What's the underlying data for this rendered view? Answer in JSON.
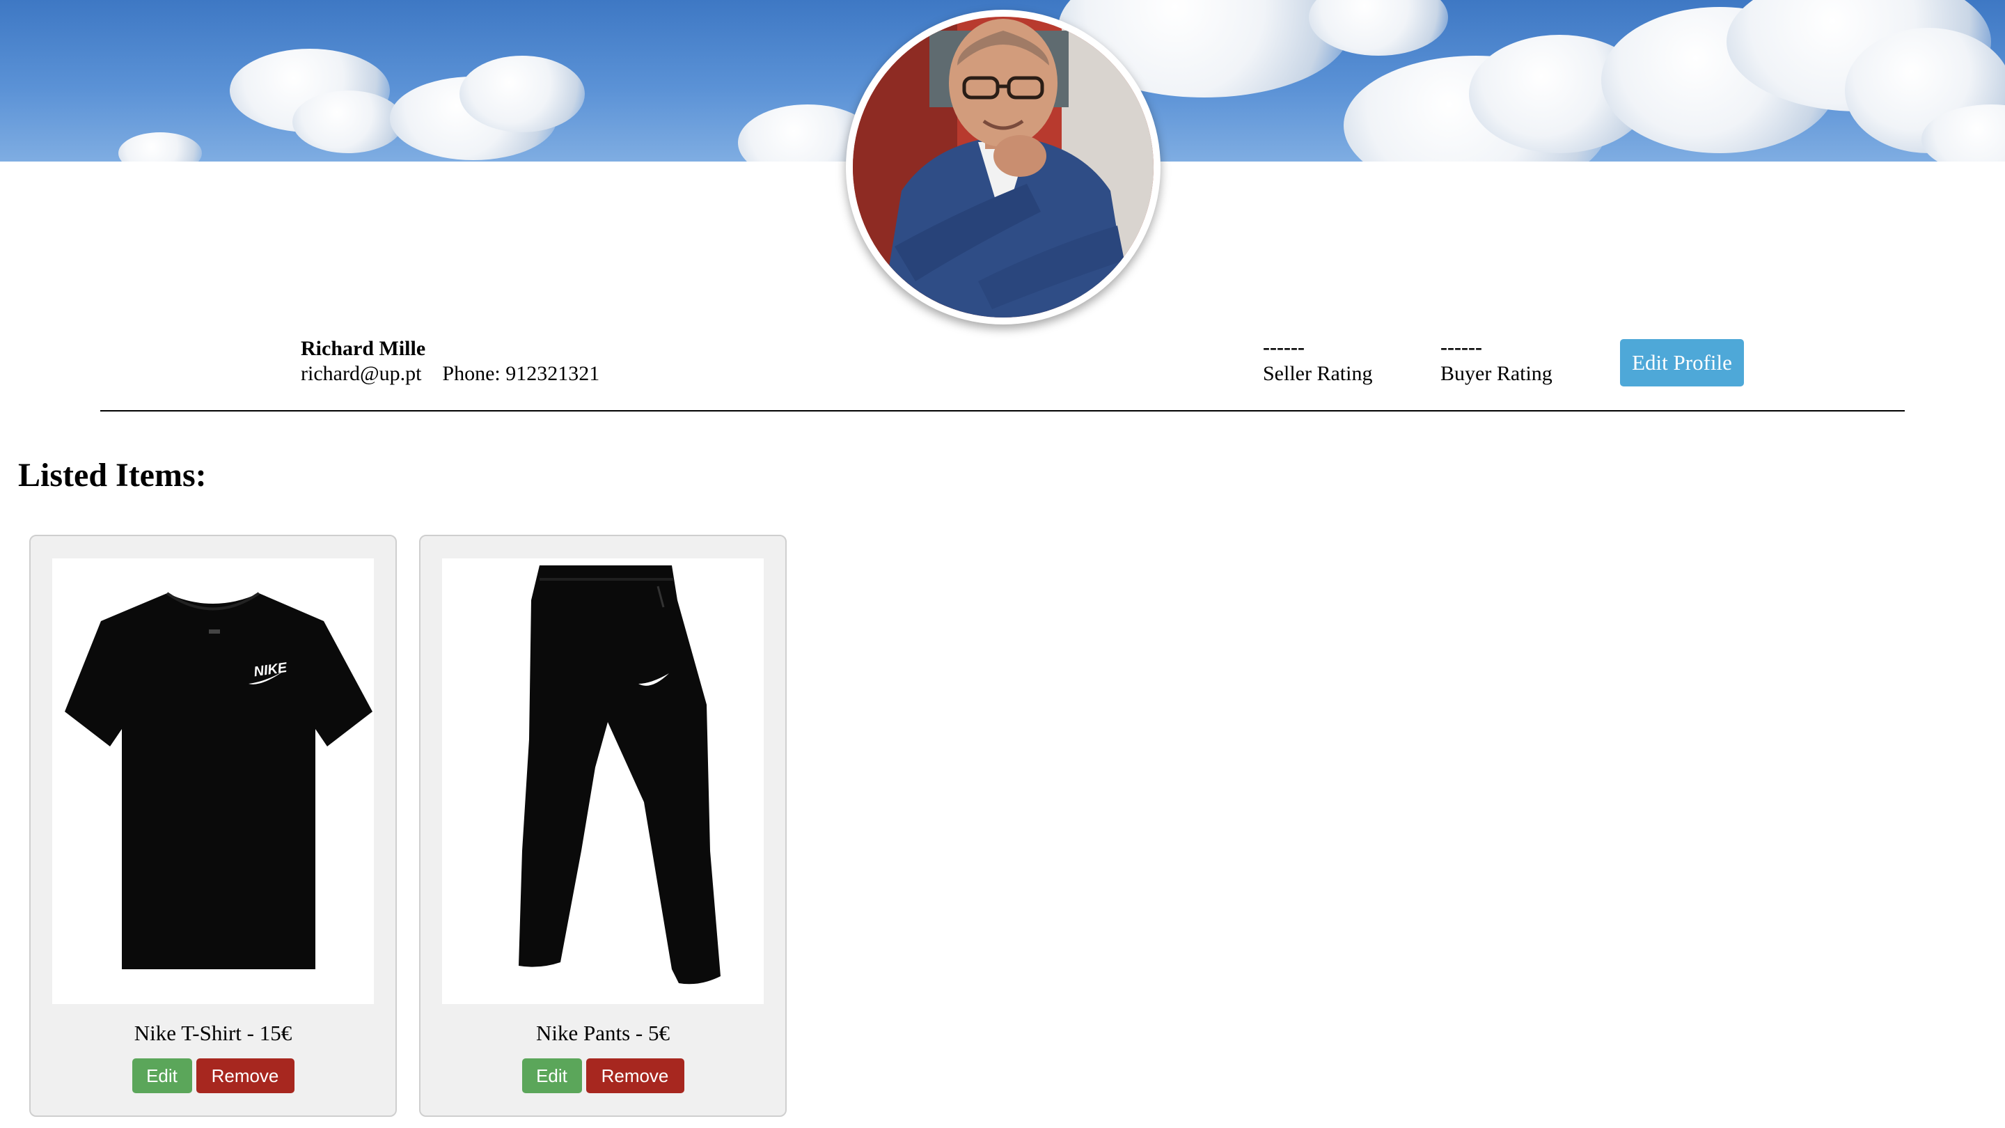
{
  "banner": {
    "alt": "sky banner"
  },
  "profile": {
    "name": "Richard Mille",
    "email": "richard@up.pt",
    "phone_label": "Phone: 912321321",
    "seller_rating_value": "------",
    "seller_rating_label": "Seller Rating",
    "buyer_rating_value": "------",
    "buyer_rating_label": "Buyer Rating",
    "edit_button": "Edit Profile"
  },
  "listed_items": {
    "heading": "Listed Items:",
    "items": [
      {
        "title": "Nike T-Shirt - 15€",
        "image": "black-tshirt-icon",
        "edit_label": "Edit",
        "remove_label": "Remove"
      },
      {
        "title": "Nike Pants - 5€",
        "image": "black-pants-icon",
        "edit_label": "Edit",
        "remove_label": "Remove"
      }
    ]
  },
  "colors": {
    "edit_profile": "#4ea8d8",
    "edit": "#5ba65a",
    "remove": "#a7271f",
    "card_bg": "#f0f0f0"
  }
}
